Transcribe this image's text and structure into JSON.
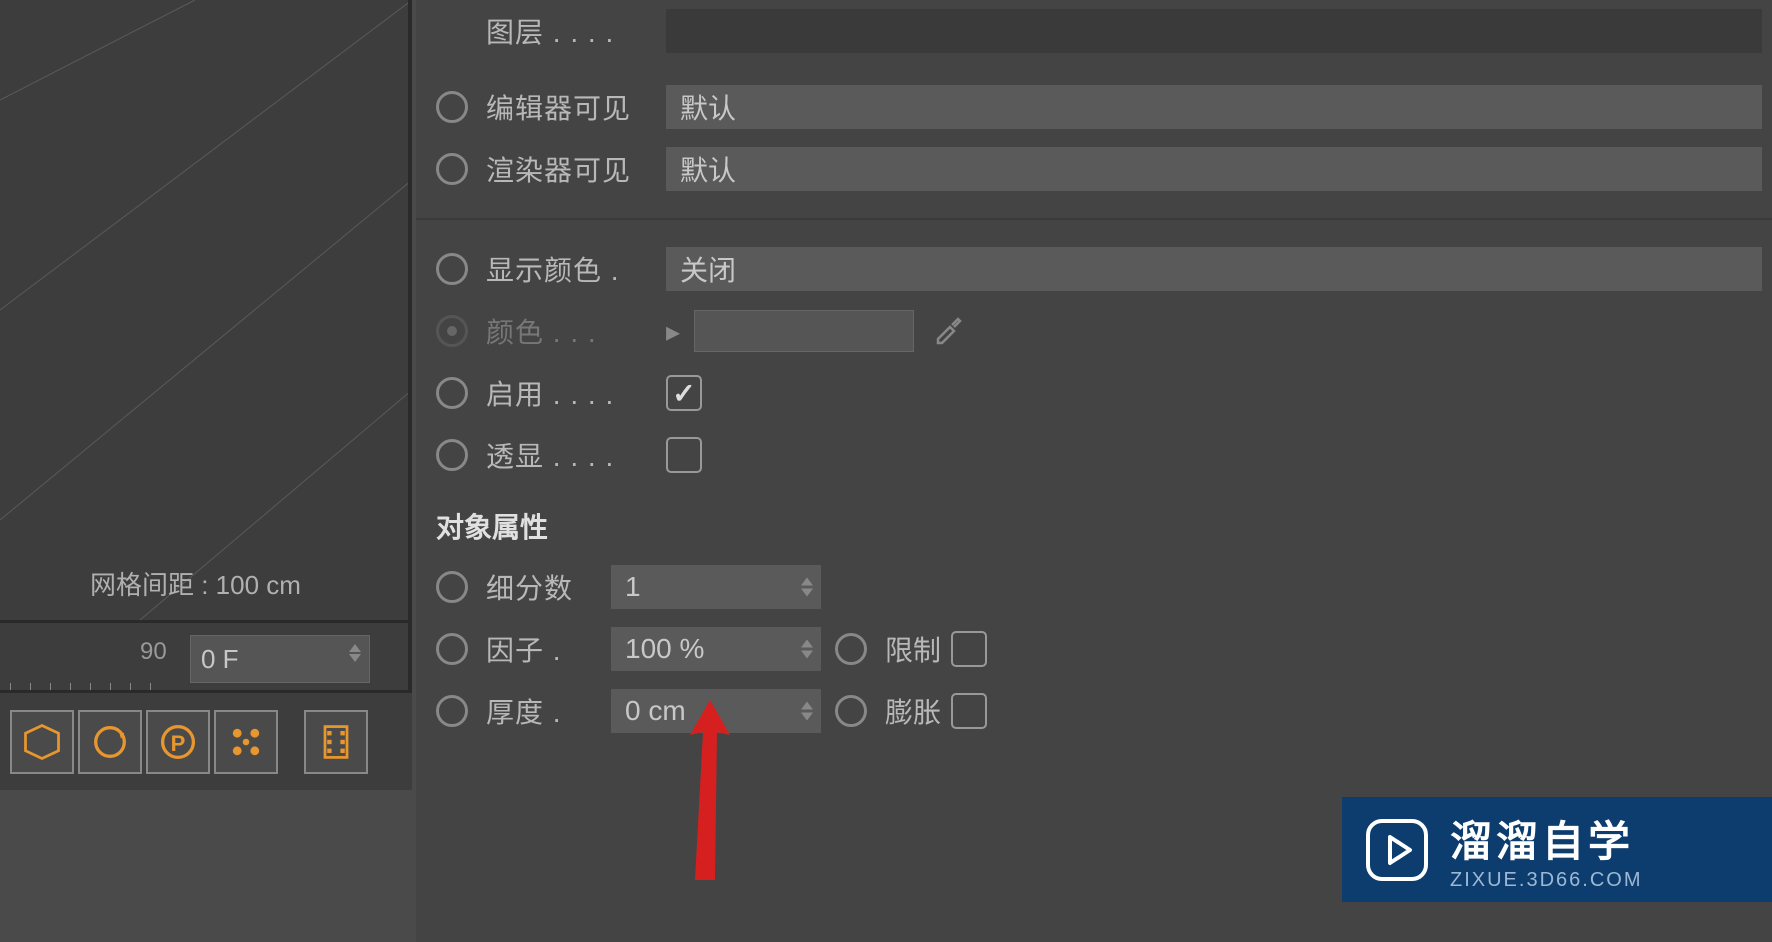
{
  "viewport": {
    "grid_info": "网格间距 : 100 cm"
  },
  "timeline": {
    "marker": "90",
    "frame_value": "0 F"
  },
  "properties": {
    "layer": {
      "label": "图层 . . . ."
    },
    "editor_visible": {
      "label": "编辑器可见",
      "value": "默认"
    },
    "renderer_visible": {
      "label": "渲染器可见",
      "value": "默认"
    },
    "display_color": {
      "label": "显示颜色 .",
      "value": "关闭"
    },
    "color": {
      "label": "颜色 . . ."
    },
    "enable": {
      "label": "启用 . . . ."
    },
    "transparency": {
      "label": "透显 . . . ."
    }
  },
  "object_attributes": {
    "header": "对象属性",
    "subdivisions": {
      "label": "细分数",
      "value": "1"
    },
    "factor": {
      "label": "因子 .",
      "value": "100 %"
    },
    "limit": {
      "label": "限制"
    },
    "thickness": {
      "label": "厚度 .",
      "value": "0 cm"
    },
    "expand": {
      "label": "膨胀"
    }
  },
  "watermark": {
    "title": "溜溜自学",
    "subtitle": "ZIXUE.3D66.COM"
  }
}
